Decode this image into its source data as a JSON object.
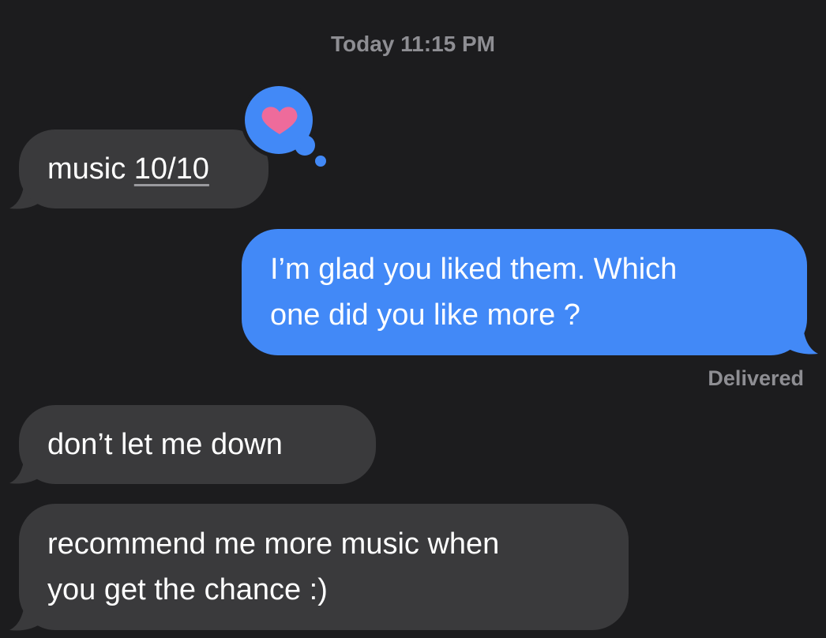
{
  "conversation": {
    "timestamp": {
      "day": "Today",
      "time": "11:15 PM"
    },
    "messages": [
      {
        "direction": "incoming",
        "prefix": "music ",
        "underlined_text": "10/10",
        "reaction": "heart"
      },
      {
        "direction": "outgoing",
        "lines": [
          "I’m glad you liked them. Which",
          "one did you like more ?"
        ],
        "status": "Delivered"
      },
      {
        "direction": "incoming",
        "text": "don’t let me down"
      },
      {
        "direction": "incoming",
        "lines": [
          "recommend me more music when",
          "you get the chance :)"
        ]
      }
    ]
  },
  "colors": {
    "background": "#1c1c1e",
    "incoming_bubble": "#3a3a3c",
    "outgoing_bubble": "#4289f7",
    "heart": "#ee6b9b",
    "meta_text": "#8e8e93"
  },
  "icons": {
    "reaction": "heart-icon"
  }
}
